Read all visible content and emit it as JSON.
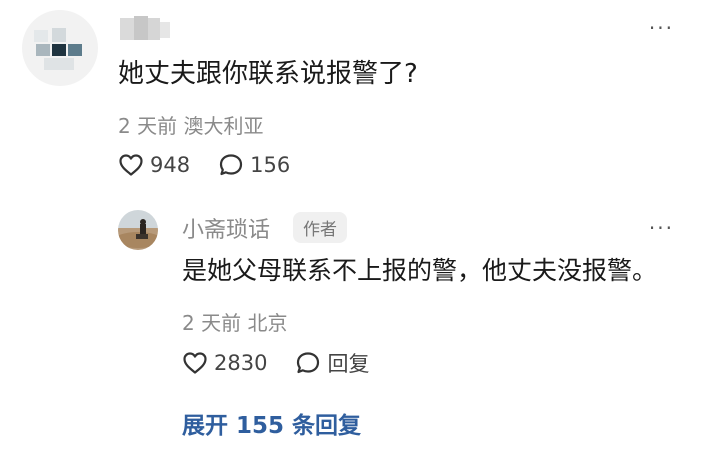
{
  "comment": {
    "more_label": "···",
    "text": "她丈夫跟你联系说报警了?",
    "meta": "2 天前 澳大利亚",
    "likes": "948",
    "replies": "156"
  },
  "reply": {
    "username": "小斋琐话",
    "badge": "作者",
    "more_label": "···",
    "text": "是她父母联系不上报的警，他丈夫没报警。",
    "meta": "2 天前 北京",
    "likes": "2830",
    "reply_label": "回复"
  },
  "expand_label": "展开 155 条回复",
  "colors": {
    "link": "#2f5e9e",
    "meta": "#8a8a8a",
    "text": "#1a1a1a"
  }
}
